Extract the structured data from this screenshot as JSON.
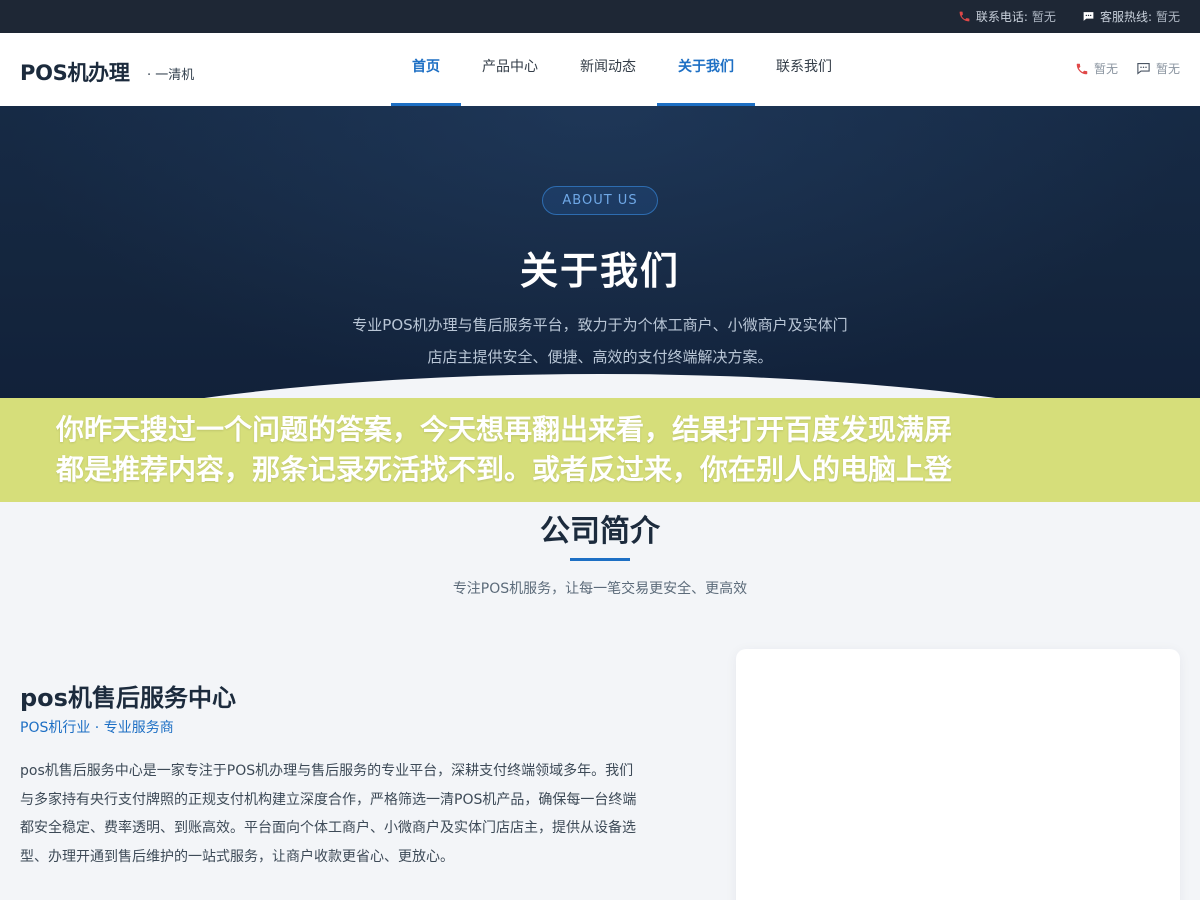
{
  "topbar": {
    "phone_label": "联系电话:",
    "phone_value": "暂无",
    "hotline_label": "客服热线:",
    "hotline_value": "暂无"
  },
  "header": {
    "logo": "POS机办理",
    "logo_sub": "· 一清机",
    "nav": [
      {
        "label": "首页",
        "active": true
      },
      {
        "label": "产品中心",
        "active": false
      },
      {
        "label": "新闻动态",
        "active": false
      },
      {
        "label": "关于我们",
        "active": true
      },
      {
        "label": "联系我们",
        "active": false
      }
    ],
    "phone_value": "暂无",
    "chat_value": "暂无"
  },
  "hero": {
    "badge": "ABOUT US",
    "title": "关于我们",
    "desc_line1": "专业POS机办理与售后服务平台，致力于为个体工商户、小微商户及实体门",
    "desc_line2": "店店主提供安全、便捷、高效的支付终端解决方案。"
  },
  "overlay": {
    "line1": "你昨天搜过一个问题的答案，今天想再翻出来看，结果打开百度发现满屏",
    "line2": "都是推荐内容，那条记录死活找不到。或者反过来，你在别人的电脑上登"
  },
  "section": {
    "title": "公司简介",
    "subtitle": "专注POS机服务，让每一笔交易更安全、更高效"
  },
  "intro": {
    "name": "pos机售后服务中心",
    "tag": "POS机行业 · 专业服务商",
    "lines": [
      "pos机售后服务中心是一家专注于POS机办理与售后服务的专业平台，深耕支付终端领域多年。我们",
      "与多家持有央行支付牌照的正规支付机构建立深度合作，严格筛选一清POS机产品，确保每一台终端",
      "都安全稳定、费率透明、到账高效。平台面向个体工商户、小微商户及实体门店店主，提供从设备选",
      "型、办理开通到售后维护的一站式服务，让商户收款更省心、更放心。"
    ]
  },
  "colors": {
    "accent": "#1d6fc4",
    "topbar_bg": "#1e2735",
    "hero_bg": "#14253d",
    "overlay_bg": "#d6de7a"
  }
}
